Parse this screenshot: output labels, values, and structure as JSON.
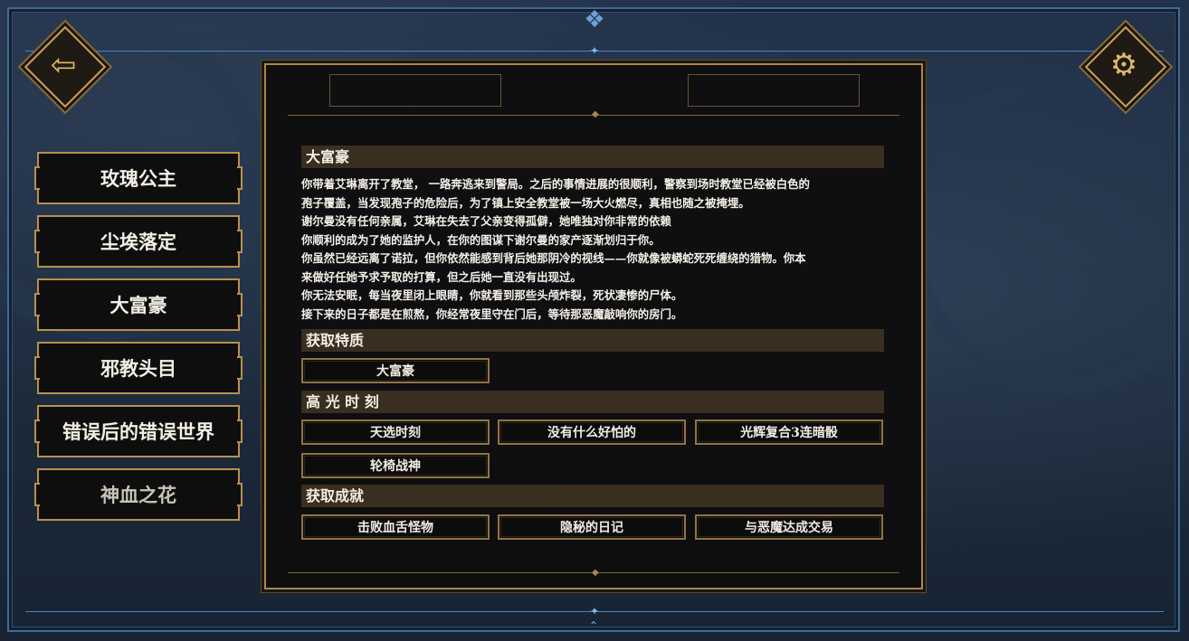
{
  "nav": {
    "back_icon": "back-arrow-icon",
    "settings_icon": "gear-icon"
  },
  "endings_menu": {
    "items": [
      {
        "label": "玫瑰公主"
      },
      {
        "label": "尘埃落定"
      },
      {
        "label": "大富豪"
      },
      {
        "label": "邪教头目"
      },
      {
        "label": "错误后的错误世界"
      },
      {
        "label": "神血之花"
      }
    ]
  },
  "detail": {
    "title": "大富豪",
    "story_lines": [
      "你带着艾琳离开了教堂， 一路奔逃来到警局。之后的事情进展的很顺利，警察到场时教堂已经被白色的",
      "孢子覆盖，当发现孢子的危险后，为了镇上安全教堂被一场大火燃尽，真相也随之被掩埋。",
      "谢尔曼没有任何亲属，艾琳在失去了父亲变得孤僻，她唯独对你非常的依赖",
      "你顺利的成为了她的监护人，在你的图谋下谢尔曼的家产逐渐划归于你。",
      "你虽然已经远离了诺拉，但你依然能感到背后她那阴冷的视线——你就像被蟒蛇死死缠绕的猎物。你本",
      "来做好任她予求予取的打算，但之后她一直没有出现过。",
      "你无法安眠，每当夜里闭上眼睛，你就看到那些头颅炸裂，死状凄惨的尸体。",
      "接下来的日子都是在煎熬，你经常夜里守在门后，等待那恶魔敲响你的房门。"
    ],
    "traits_heading": "获取特质",
    "traits": [
      "大富豪"
    ],
    "highlights_heading": "高 光 时 刻",
    "highlights": [
      "天选时刻",
      "没有什么好怕的",
      "光辉复合3连暗骰",
      "轮椅战神"
    ],
    "achievements_heading": "获取成就",
    "achievements": [
      "击败血舌怪物",
      "隐秘的日记",
      "与恶魔达成交易"
    ]
  },
  "colors": {
    "gold_border": "#b6914f",
    "blue_frame": "#3f6a9a",
    "section_header_bg": "#3a2e20"
  }
}
